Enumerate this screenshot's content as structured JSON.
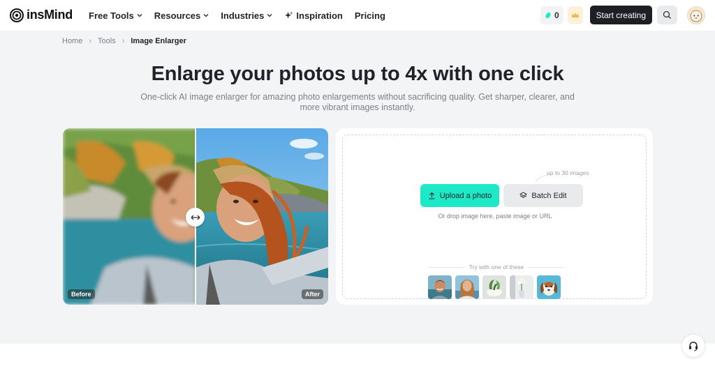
{
  "nav": {
    "brand": "insMind",
    "menu": [
      {
        "label": "Free Tools"
      },
      {
        "label": "Resources"
      },
      {
        "label": "Industries"
      },
      {
        "label": "Inspiration"
      },
      {
        "label": "Pricing"
      }
    ],
    "credits": "0",
    "start_label": "Start creating"
  },
  "breadcrumb": {
    "items": [
      "Home",
      "Tools",
      "Image Enlarger"
    ]
  },
  "hero": {
    "title": "Enlarge your photos up to 4x with one click",
    "subtitle": "One-click AI image enlarger for amazing photo enlargements without sacrificing quality. Get sharper, clearer, and more vibrant images instantly."
  },
  "compare": {
    "before_label": "Before",
    "after_label": "After"
  },
  "upload": {
    "upload_label": "Upload a photo",
    "batch_label": "Batch Edit",
    "limit_note": "up to 30 images",
    "hint": "Or drop image here, paste image or URL",
    "try_label": "Try with one of these",
    "samples": [
      "man-portrait",
      "woman-portrait",
      "plant-pot",
      "flower-vase",
      "dog"
    ]
  },
  "colors": {
    "accent": "#1de9c7",
    "dark_button": "#1d1f24",
    "page_bg": "#f3f4f6"
  }
}
